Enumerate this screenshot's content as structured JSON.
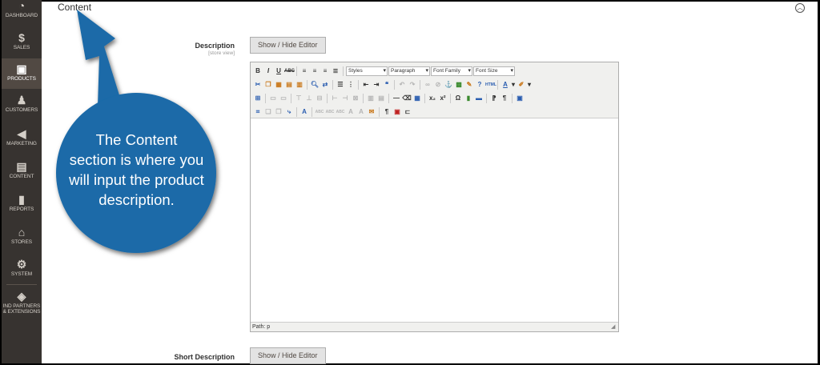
{
  "sidebar": {
    "items": [
      {
        "label": "DASHBOARD",
        "icon": "dashboard-icon"
      },
      {
        "label": "SALES",
        "icon": "dollar-icon"
      },
      {
        "label": "PRODUCTS",
        "icon": "box-icon"
      },
      {
        "label": "CUSTOMERS",
        "icon": "person-icon"
      },
      {
        "label": "MARKETING",
        "icon": "megaphone-icon"
      },
      {
        "label": "CONTENT",
        "icon": "layout-icon"
      },
      {
        "label": "REPORTS",
        "icon": "bar-chart-icon"
      },
      {
        "label": "STORES",
        "icon": "store-icon"
      },
      {
        "label": "SYSTEM",
        "icon": "gear-icon"
      },
      {
        "label_line1": "IND PARTNERS",
        "label_line2": "& EXTENSIONS",
        "icon": "cube-icon"
      }
    ]
  },
  "section": {
    "title": "Content"
  },
  "description": {
    "label": "Description",
    "sublabel": "[store view]",
    "toggle_label": "Show / Hide Editor"
  },
  "short_description": {
    "label": "Short Description",
    "toggle_label": "Show / Hide Editor"
  },
  "editor": {
    "styles_select": "Styles",
    "paragraph_select": "Paragraph",
    "font_family_select": "Font Family",
    "font_size_select": "Font Size",
    "status_path": "Path: p"
  },
  "callout": {
    "line1": "The Content",
    "line2": "section is where you",
    "line3": "will input the product",
    "line4": "description.",
    "color": "#1a6aa8"
  }
}
